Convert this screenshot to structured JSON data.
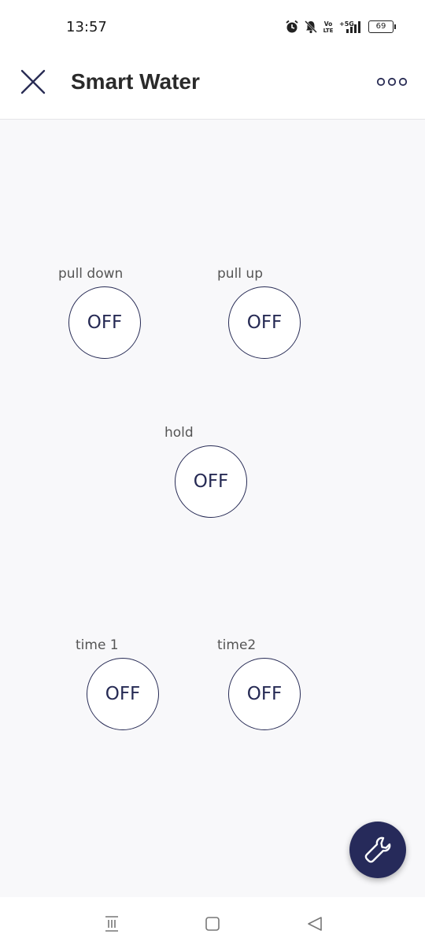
{
  "status_bar": {
    "time": "13:57",
    "battery_level": "69",
    "icons": [
      "alarm-icon",
      "bell-off-icon",
      "volte-icon",
      "5g-signal-icon",
      "battery-icon"
    ],
    "volte_text": "Vo\nLTE",
    "network_text": "5G"
  },
  "app_bar": {
    "title": "Smart Water",
    "close_icon": "close-icon",
    "more_icon": "more-options-icon"
  },
  "switches": [
    {
      "label": "pull down",
      "state": "OFF"
    },
    {
      "label": "pull up",
      "state": "OFF"
    },
    {
      "label": "hold",
      "state": "OFF"
    },
    {
      "label": "time 1",
      "state": "OFF"
    },
    {
      "label": "time2",
      "state": "OFF"
    }
  ],
  "fab": {
    "icon": "wrench-icon"
  },
  "nav_bar": {
    "icons": [
      "recent-apps-icon",
      "home-icon",
      "back-icon"
    ]
  },
  "colors": {
    "accent": "#262a54",
    "background": "#f8f8fa",
    "header": "#ffffff"
  }
}
